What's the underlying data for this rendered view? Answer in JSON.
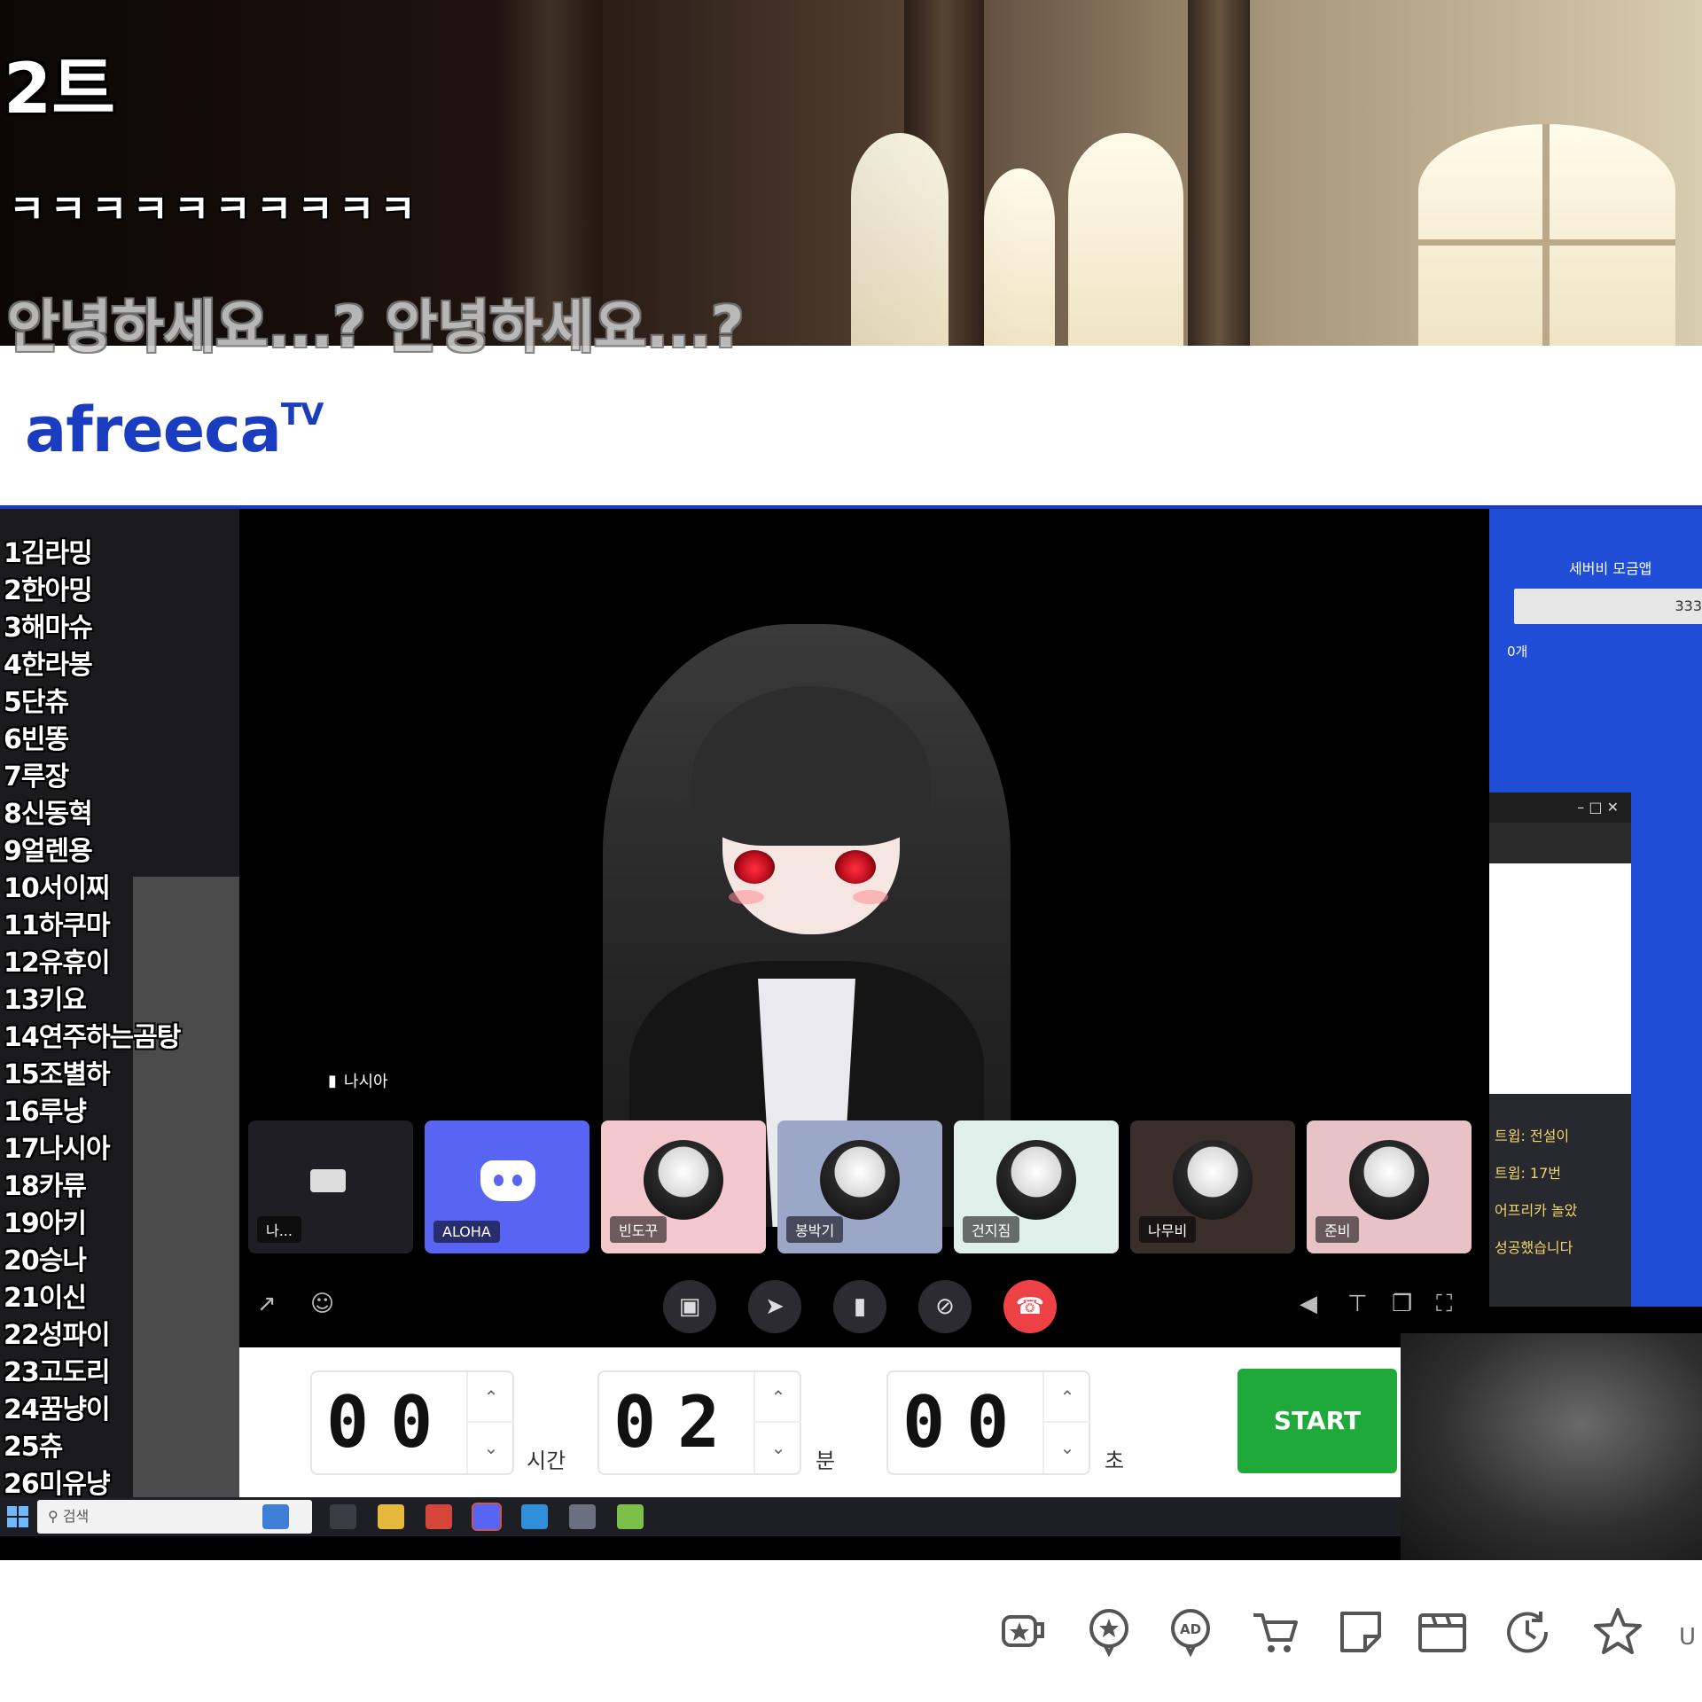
{
  "overlay_chat": {
    "line1": "2트",
    "line2": "ㅋㅋㅋㅋㅋㅋㅋㅋㅋㅋ",
    "line3": "안녕하세요...? 안녕하세요...?"
  },
  "header": {
    "logo_text": "afreeca",
    "logo_suffix": "TV",
    "brand_color": "#1a3cbe"
  },
  "ranking": [
    "1김라밍",
    "2한아밍",
    "3해마슈",
    "4한라봉",
    "5단츄",
    "6빈똥",
    "7루장",
    "8신동혁",
    "9얼렌용",
    "10서이찌",
    "11하쿠마",
    "12유휴이",
    "13키요",
    "14연주하는곰탕",
    "15조별하",
    "16루냥",
    "17나시아",
    "18카류",
    "19아키",
    "20승나",
    "21이신",
    "22성파이",
    "23고도리",
    "24꿈냥이",
    "25츄",
    "26미유냥"
  ],
  "discord": {
    "speaking_user": "나시아",
    "tiles": [
      {
        "label": "나...",
        "bg": "#1f1f23"
      },
      {
        "label": "ALOHA",
        "bg": "#5865f2",
        "icon": "discord-icon"
      },
      {
        "label": "빈도꾸",
        "bg": "#f2c8cc"
      },
      {
        "label": "봉박기",
        "bg": "#9aa7c7"
      },
      {
        "label": "건지짐",
        "bg": "#dff0ea"
      },
      {
        "label": "나무비",
        "bg": "#3a2f2a"
      },
      {
        "label": "준비",
        "bg": "#e7c3c8"
      }
    ],
    "controls": [
      "screen-share-icon",
      "rocket-icon",
      "chat-icon",
      "mic-off-icon",
      "hangup-icon"
    ],
    "accent_red": "#ed4245"
  },
  "timer": {
    "hours": "00",
    "minutes": "02",
    "seconds": "00",
    "hours_unit": "시간",
    "minutes_unit": "분",
    "seconds_unit": "초",
    "start_label": "START",
    "start_color": "#1fa93a"
  },
  "taskbar": {
    "search_placeholder": "검색"
  },
  "right_panel": {
    "title": "세버비 모금앱",
    "field_value": "333",
    "sub": "0개",
    "chat_lines": [
      "트윕: 전설이",
      "트윕: 17번",
      "어프리카 놀았",
      "성공했습니다"
    ]
  },
  "bottom_bar": {
    "icons": [
      "star-gift-icon",
      "star-balloon-icon",
      "ad-balloon-icon",
      "cart-icon",
      "sticker-icon",
      "clapper-icon",
      "clock-icon",
      "favorite-star-icon"
    ],
    "more_label": "U"
  }
}
